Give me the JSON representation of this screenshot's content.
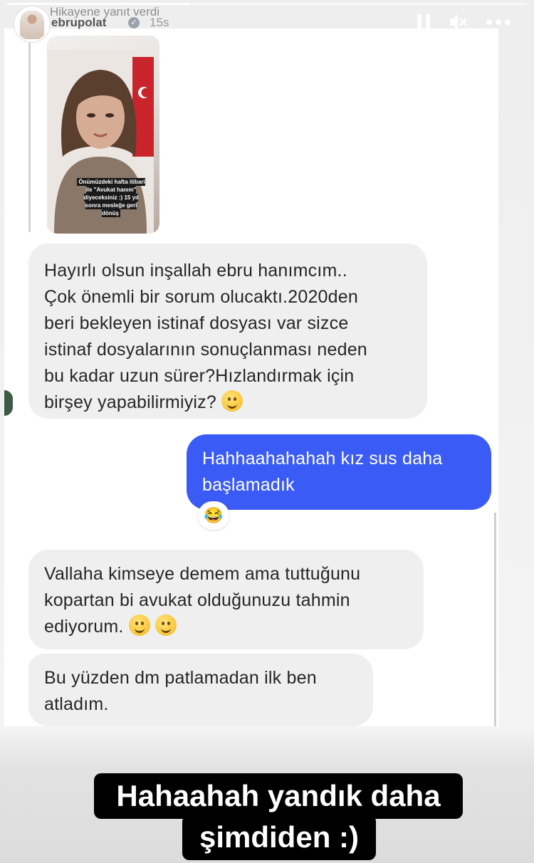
{
  "story": {
    "header_label": "Hikayene yanıt verdi",
    "username": "ebrupolat",
    "time_ago": "15s",
    "progress_fraction": 0.35
  },
  "replied_story": {
    "caption": "Önümüzdeki hafta itibari ile \"Avukat hanım\" diyeceksiniz :) 15 yıl sonra mesleğe geri dönüş"
  },
  "chat": {
    "incoming_1": [
      "Hayırlı olsun inşallah ebru hanımcım..",
      "Çok önemli bir sorum olucaktı.2020den",
      "beri bekleyen  istinaf dosyası var sizce",
      "istinaf dosyalarının sonuçlanması neden",
      "bu kadar uzun sürer?Hızlandırmak için",
      "birşey yapabilirmiyiz?"
    ],
    "outgoing_1": [
      "Hahhaahahahah kız sus daha",
      "başlamadık"
    ],
    "reaction": "😂",
    "incoming_2": [
      "Vallaha kimseye demem ama tuttuğunu",
      "kopartan bi avukat olduğunuzu tahmin",
      "ediyorum."
    ],
    "incoming_3": [
      "Bu yüzden dm patlamadan ilk ben",
      "atladım."
    ]
  },
  "overlay_caption": {
    "line1": "Hahaahah yandık daha",
    "line2": "şimdiden :)"
  },
  "icons": {
    "pause": "pause-icon",
    "mute": "muted-speaker-icon",
    "more": "more-dots-icon",
    "verified": "verified-badge-icon"
  }
}
